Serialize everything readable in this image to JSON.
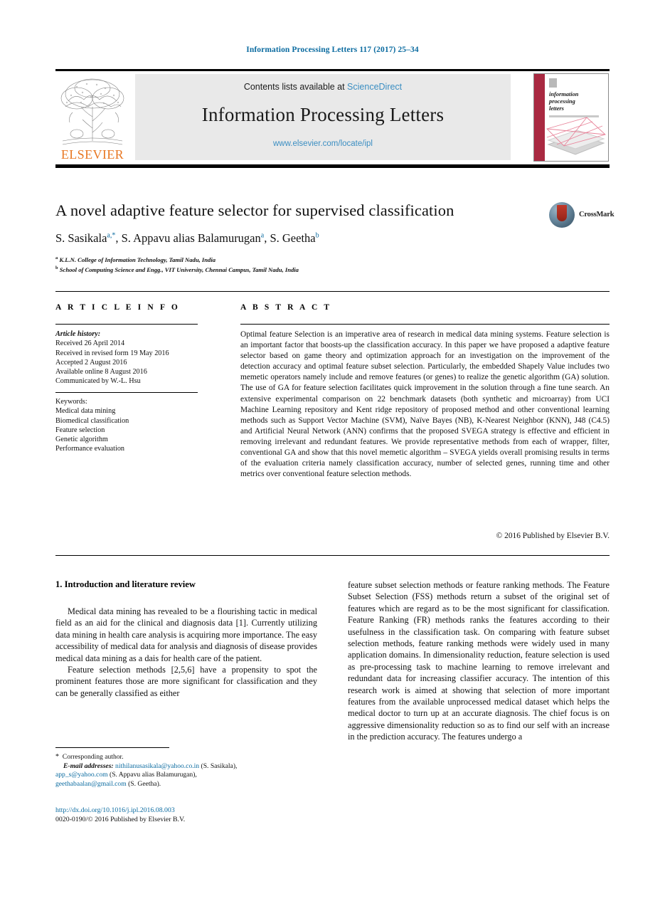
{
  "running_head": "Information Processing Letters 117 (2017) 25–34",
  "masthead": {
    "contents_prefix": "Contents lists available at ",
    "sciencedirect": "ScienceDirect",
    "journal_title": "Information Processing Letters",
    "journal_url": "www.elsevier.com/locate/ipl",
    "publisher_wordmark": "ELSEVIER",
    "cover": {
      "line1": "information",
      "line2": "processing",
      "line3": "letters"
    }
  },
  "article": {
    "title": "A novel adaptive feature selector for supervised classification",
    "authors": [
      {
        "name": "S. Sasikala",
        "marks": "a,*"
      },
      {
        "name": "S. Appavu alias Balamurugan",
        "marks": "a"
      },
      {
        "name": "S. Geetha",
        "marks": "b"
      }
    ],
    "affiliations": [
      {
        "mark": "a",
        "text": "K.L.N. College of Information Technology, Tamil Nadu, India"
      },
      {
        "mark": "b",
        "text": "School of Computing Science and Engg., VIT University, Chennai Campus, Tamil Nadu, India"
      }
    ],
    "crossmark_label": "CrossMark"
  },
  "info": {
    "header": "A R T I C L E   I N F O",
    "history_label": "Article history:",
    "history": [
      "Received 26 April 2014",
      "Received in revised form 19 May 2016",
      "Accepted 2 August 2016",
      "Available online 8 August 2016",
      "Communicated by W.-L. Hsu"
    ],
    "keywords_label": "Keywords:",
    "keywords": [
      "Medical data mining",
      "Biomedical classification",
      "Feature selection",
      "Genetic algorithm",
      "Performance evaluation"
    ]
  },
  "abstract": {
    "header": "A B S T R A C T",
    "text": "Optimal feature Selection is an imperative area of research in medical data mining systems. Feature selection is an important factor that boosts-up the classification accuracy. In this paper we have proposed a adaptive feature selector based on game theory and optimization approach for an investigation on the improvement of the detection accuracy and optimal feature subset selection. Particularly, the embedded Shapely Value includes two memetic operators namely include and remove features (or genes) to realize the genetic algorithm (GA) solution. The use of GA for feature selection facilitates quick improvement in the solution through a fine tune search. An extensive experimental comparison on 22 benchmark datasets (both synthetic and microarray) from UCI Machine Learning repository and Kent ridge repository of proposed method and other conventional learning methods such as Support Vector Machine (SVM), Naïve Bayes (NB), K-Nearest Neighbor (KNN), J48 (C4.5) and Artificial Neural Network (ANN) confirms that the proposed SVEGA strategy is effective and efficient in removing irrelevant and redundant features. We provide representative methods from each of wrapper, filter, conventional GA and show that this novel memetic algorithm – SVEGA yields overall promising results in terms of the evaluation criteria namely classification accuracy, number of selected genes, running time and other metrics over conventional feature selection methods.",
    "copyright": "© 2016 Published by Elsevier B.V."
  },
  "body": {
    "section_heading": "1. Introduction and literature review",
    "left_paragraphs": [
      "Medical data mining has revealed to be a flourishing tactic in medical field as an aid for the clinical and diagnosis data [1]. Currently utilizing data mining in health care analysis is acquiring more importance. The easy accessibility of medical data for analysis and diagnosis of disease provides medical data mining as a dais for health care of the patient.",
      "Feature selection methods [2,5,6] have a propensity to spot the prominent features those are more significant for classification and they can be generally classified as either"
    ],
    "right_paragraphs": [
      "feature subset selection methods or feature ranking methods. The Feature Subset Selection (FSS) methods return a subset of the original set of features which are regard as to be the most significant for classification. Feature Ranking (FR) methods ranks the features according to their usefulness in the classification task. On comparing with feature subset selection methods, feature ranking methods were widely used in many application domains. In dimensionality reduction, feature selection is used as pre-processing task to machine learning to remove irrelevant and redundant data for increasing classifier accuracy. The intention of this research work is aimed at showing that selection of more important features from the available unprocessed medical dataset which helps the medical doctor to turn up at an accurate diagnosis. The chief focus is on aggressive dimensionality reduction so as to find our self with an increase in the prediction accuracy. The features undergo a"
    ]
  },
  "footnote": {
    "corresponding": "Corresponding author.",
    "email_label": "E-mail addresses:",
    "emails": [
      {
        "address": "nithilanusasikala@yahoo.co.in",
        "owner": "(S. Sasikala),"
      },
      {
        "address": "app_s@yahoo.com",
        "owner": "(S. Appavu alias Balamurugan),"
      },
      {
        "address": "geethabaalan@gmail.com",
        "owner": "(S. Geetha)."
      }
    ],
    "doi": "http://dx.doi.org/10.1016/j.ipl.2016.08.003",
    "issn_line": "0020-0190/© 2016 Published by Elsevier B.V."
  },
  "colors": {
    "link": "#0b6ba0",
    "sciencedirect": "#3b8ec2",
    "elsevier_orange": "#E87722",
    "cover_red": "#a92941"
  }
}
